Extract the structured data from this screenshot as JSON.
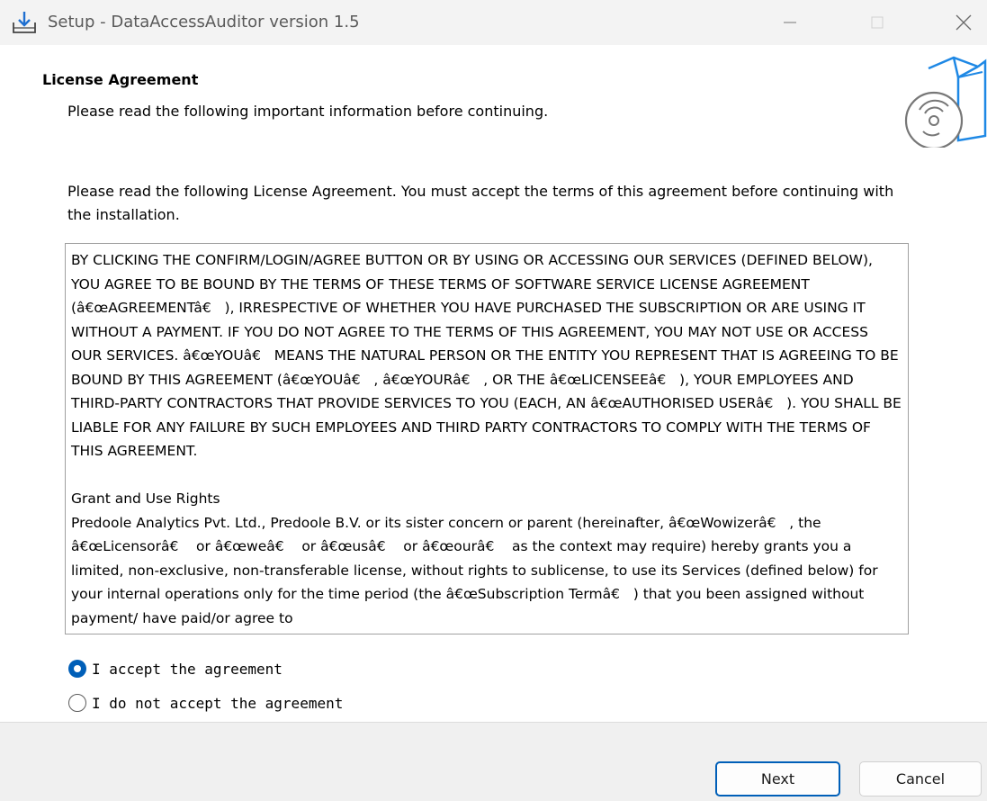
{
  "window": {
    "title": "Setup - DataAccessAuditor version 1.5",
    "icon": "installer-download-icon",
    "controls": [
      "minimize-icon",
      "maximize-icon",
      "close-icon"
    ]
  },
  "header": {
    "title": "License Agreement",
    "subtitle": "Please read the following important information before continuing.",
    "icon": "box-with-disc-icon"
  },
  "content": {
    "intro": "Please read the following License Agreement. You must accept the terms of this agreement before continuing with the installation.",
    "license_text": "BY CLICKING THE CONFIRM/LOGIN/AGREE BUTTON OR BY USING OR ACCESSING OUR SERVICES (DEFINED BELOW), YOU AGREE TO BE BOUND BY THE TERMS OF THESE TERMS OF SOFTWARE SERVICE LICENSE AGREEMENT (â€œAGREEMENTâ€   ), IRRESPECTIVE OF WHETHER YOU HAVE PURCHASED THE SUBSCRIPTION OR ARE USING IT WITHOUT A PAYMENT. IF YOU DO NOT AGREE TO THE TERMS OF THIS AGREEMENT, YOU MAY NOT USE OR ACCESS OUR SERVICES. â€œYOUâ€   MEANS THE NATURAL PERSON OR THE ENTITY YOU REPRESENT THAT IS AGREEING TO BE BOUND BY THIS AGREEMENT (â€œYOUâ€   , â€œYOURâ€   , OR THE â€œLICENSEEâ€   ), YOUR EMPLOYEES AND THIRD-PARTY CONTRACTORS THAT PROVIDE SERVICES TO YOU (EACH, AN â€œAUTHORISED USERâ€   ). YOU SHALL BE LIABLE FOR ANY FAILURE BY SUCH EMPLOYEES AND THIRD PARTY CONTRACTORS TO COMPLY WITH THE TERMS OF THIS AGREEMENT.\n\nGrant and Use Rights\nPredoole Analytics Pvt. Ltd., Predoole B.V. or its sister concern or parent (hereinafter, â€œWowizerâ€   , the â€œLicensorâ€    or â€œweâ€    or â€œusâ€    or â€œourâ€    as the context may require) hereby grants you a limited, non-exclusive, non-transferable license, without rights to sublicense, to use its Services (defined below) for your internal operations only for the time period (the â€œSubscription Termâ€   ) that you been assigned without payment/ have paid/or agree to"
  },
  "options": {
    "accept_label": "I accept the agreement",
    "decline_label": "I do not accept the agreement",
    "selected": "accept"
  },
  "footer": {
    "next_label": "Next",
    "cancel_label": "Cancel"
  },
  "colors": {
    "accent": "#005fb8",
    "titlebar": "#f3f3f3",
    "footer": "#f0f0f0"
  }
}
